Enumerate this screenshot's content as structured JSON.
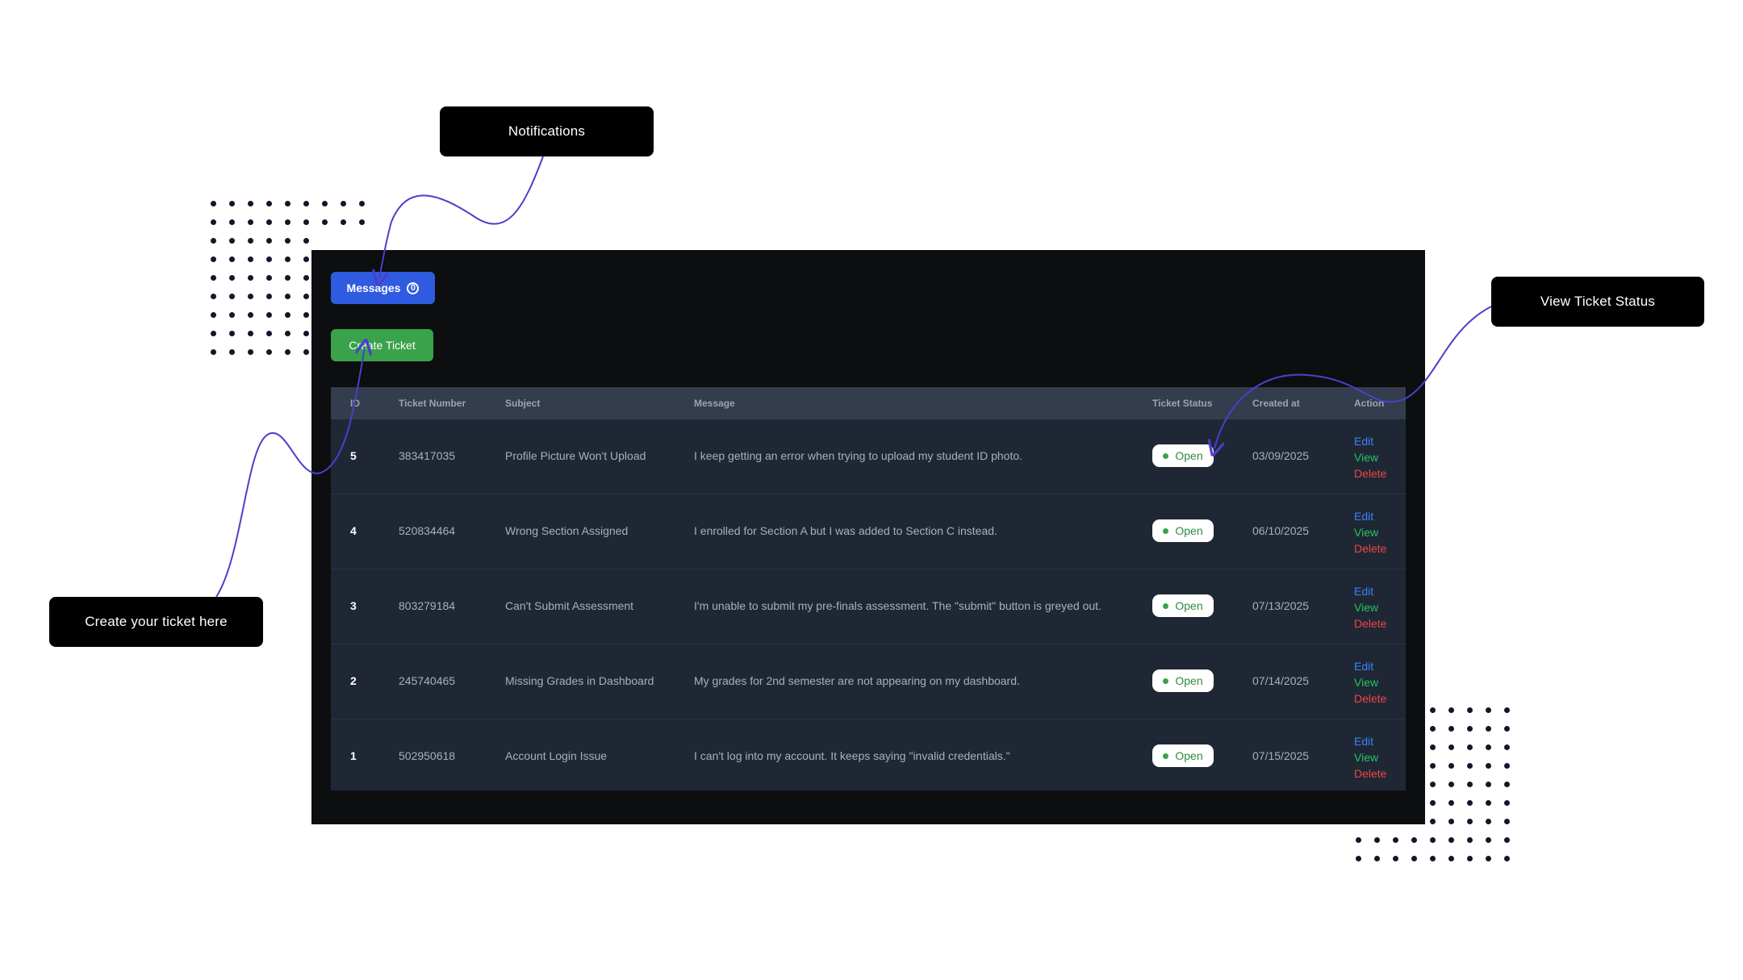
{
  "callouts": {
    "notifications": "Notifications",
    "view_status": "View Ticket Status",
    "create_ticket": "Create your ticket here"
  },
  "toolbar": {
    "messages_label": "Messages",
    "messages_count": "0",
    "create_label": "Create Ticket"
  },
  "table": {
    "headers": {
      "id": "ID",
      "ticket_number": "Ticket Number",
      "subject": "Subject",
      "message": "Message",
      "status": "Ticket Status",
      "created": "Created at",
      "action": "Action"
    },
    "rows": [
      {
        "id": "5",
        "ticket": "383417035",
        "subject": "Profile Picture Won't Upload",
        "message": "I keep getting an error when trying to upload my student ID photo.",
        "status": "Open",
        "created": "03/09/2025"
      },
      {
        "id": "4",
        "ticket": "520834464",
        "subject": "Wrong Section Assigned",
        "message": "I enrolled for Section A but I was added to Section C instead.",
        "status": "Open",
        "created": "06/10/2025"
      },
      {
        "id": "3",
        "ticket": "803279184",
        "subject": "Can't Submit Assessment",
        "message": "I'm unable to submit my pre-finals assessment. The \"submit\" button is greyed out.",
        "status": "Open",
        "created": "07/13/2025"
      },
      {
        "id": "2",
        "ticket": "245740465",
        "subject": "Missing Grades in Dashboard",
        "message": "My grades for 2nd semester are not appearing on my dashboard.",
        "status": "Open",
        "created": "07/14/2025"
      },
      {
        "id": "1",
        "ticket": "502950618",
        "subject": "Account Login Issue",
        "message": "I can't log into my account. It keeps saying \"invalid credentials.\"",
        "status": "Open",
        "created": "07/15/2025"
      }
    ],
    "actions": {
      "edit": "Edit",
      "view": "View",
      "delete": "Delete"
    }
  },
  "colors": {
    "primary": "#2f5be0",
    "success": "#3aa24a",
    "edit": "#3b82f6",
    "view": "#22c55e",
    "delete": "#ef4444",
    "connector": "#4b3fc9"
  }
}
